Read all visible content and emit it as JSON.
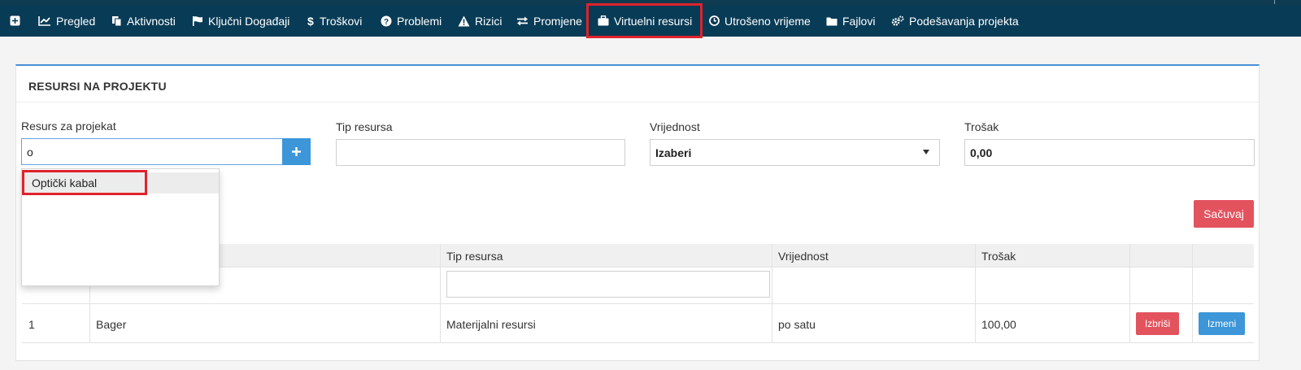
{
  "nav": {
    "items": [
      {
        "label": "Pregled",
        "icon": "line-chart-icon"
      },
      {
        "label": "Aktivnosti",
        "icon": "copy-icon"
      },
      {
        "label": "Ključni Događaji",
        "icon": "flag-icon"
      },
      {
        "label": "Troškovi",
        "icon": "dollar-icon"
      },
      {
        "label": "Problemi",
        "icon": "question-circle-icon"
      },
      {
        "label": "Rizici",
        "icon": "warning-icon"
      },
      {
        "label": "Promjene",
        "icon": "exchange-icon"
      },
      {
        "label": "Virtuelni resursi",
        "icon": "briefcase-icon"
      },
      {
        "label": "Utrošeno vrijeme",
        "icon": "clock-icon"
      },
      {
        "label": "Fajlovi",
        "icon": "folder-icon"
      },
      {
        "label": "Podešavanja projekta",
        "icon": "gears-icon"
      }
    ],
    "active": "Virtuelni resursi"
  },
  "panel": {
    "title": "RESURSI NA PROJEKTU"
  },
  "form": {
    "resource_label": "Resurs za projekat",
    "resource_value": "o",
    "type_label": "Tip resursa",
    "type_value": "",
    "value_label": "Vrijednost",
    "value_selected": "Izaberi",
    "cost_label": "Trošak",
    "cost_value": "0,00",
    "save_label": "Sačuvaj"
  },
  "autocomplete": {
    "suggestions": [
      "Optički kabal"
    ]
  },
  "table": {
    "headers": [
      "Tip resursa",
      "Vrijednost",
      "Trošak"
    ],
    "filter_value": "",
    "rows": [
      {
        "num": "1",
        "name": "Bager",
        "type": "Materijalni resursi",
        "value": "po satu",
        "cost": "100,00",
        "delete_label": "Izbriši",
        "edit_label": "Izmeni"
      }
    ]
  },
  "colors": {
    "navbar": "#083b56",
    "accent_blue": "#3c96d8",
    "danger_red": "#e2535e",
    "highlight": "#e0222b"
  }
}
